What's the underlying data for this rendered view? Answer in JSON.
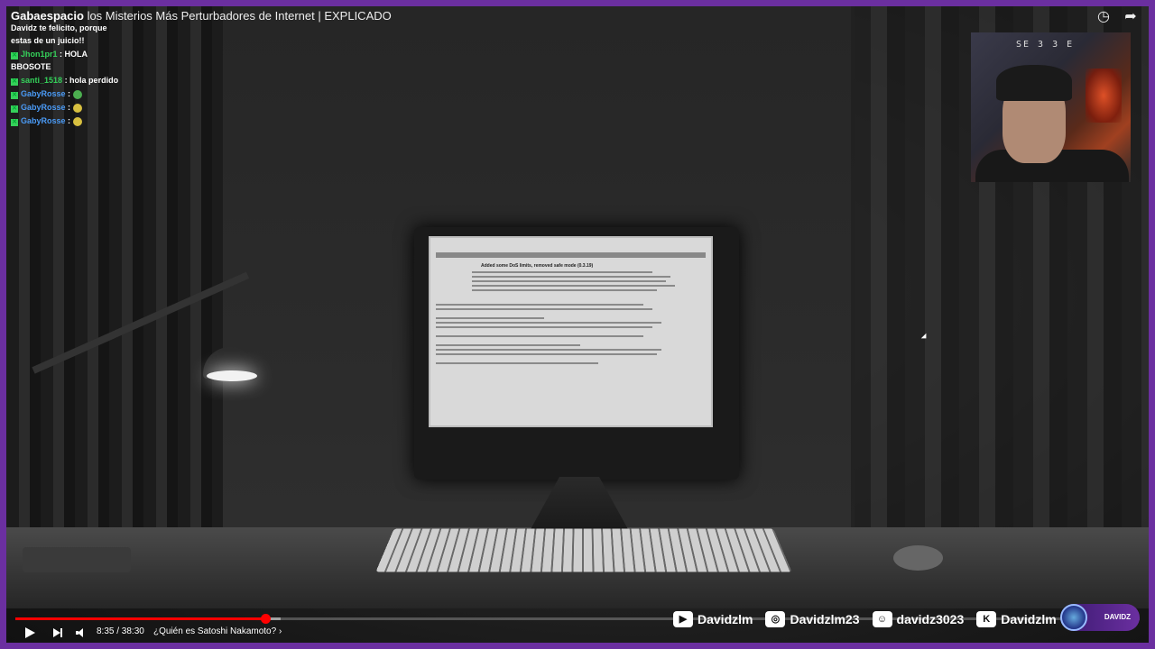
{
  "video": {
    "title_prefix": "Gabaespacio",
    "title": "los Misterios Más Perturbadores de Internet | EXPLICADO",
    "time": "8:35 / 38:30",
    "chapter": "¿Quién es Satoshi Nakamoto? ›"
  },
  "screen_text": {
    "heading": "Added some DoS limits, removed safe mode (0.3.19)"
  },
  "chat": [
    {
      "user": "",
      "text": "Davidz te felicito, porque estas de un juicio!!",
      "user_color": "white"
    },
    {
      "user": "Jhon1pr1",
      "text": ": HOLA BBOSOTE",
      "user_color": "green"
    },
    {
      "user": "santi_1518",
      "text": ": hola perdido",
      "user_color": "green"
    },
    {
      "user": "GabyRosse",
      "text": ":",
      "user_color": "blue",
      "emote": "#4caf50"
    },
    {
      "user": "GabyRosse",
      "text": ":",
      "user_color": "blue",
      "emote": "#d8c040"
    },
    {
      "user": "GabyRosse",
      "text": ":",
      "user_color": "blue",
      "emote": "#d8c040"
    }
  ],
  "webcam": {
    "sign": "SE 3 3 E"
  },
  "socials": [
    {
      "icon": "youtube-icon",
      "glyph": "▶",
      "label": "Davidzlm"
    },
    {
      "icon": "instagram-icon",
      "glyph": "◎",
      "label": "Davidzlm23"
    },
    {
      "icon": "discord-icon",
      "glyph": "☺",
      "label": "davidz3023"
    },
    {
      "icon": "kick-icon",
      "glyph": "K",
      "label": "Davidzlm"
    }
  ],
  "logo_badge": "DAVIDZ",
  "progress": {
    "played": 0.223,
    "loaded": 0.236
  },
  "colors": {
    "frame": "#6b2fa0",
    "progress": "#ff0000",
    "chat_green": "#35d05a",
    "chat_blue": "#4a9af5"
  }
}
